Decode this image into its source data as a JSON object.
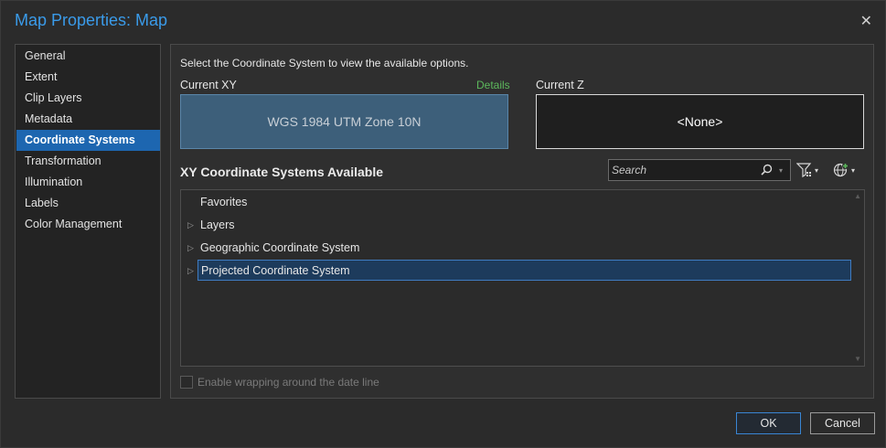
{
  "window": {
    "title": "Map Properties: Map",
    "close_glyph": "✕"
  },
  "sidebar": {
    "items": [
      {
        "label": "General",
        "selected": false
      },
      {
        "label": "Extent",
        "selected": false
      },
      {
        "label": "Clip Layers",
        "selected": false
      },
      {
        "label": "Metadata",
        "selected": false
      },
      {
        "label": "Coordinate Systems",
        "selected": true
      },
      {
        "label": "Transformation",
        "selected": false
      },
      {
        "label": "Illumination",
        "selected": false
      },
      {
        "label": "Labels",
        "selected": false
      },
      {
        "label": "Color Management",
        "selected": false
      }
    ]
  },
  "main": {
    "instruction": "Select the Coordinate System to view the available options.",
    "current_xy_label": "Current XY",
    "details_link": "Details",
    "current_xy_value": "WGS 1984 UTM Zone 10N",
    "current_z_label": "Current Z",
    "current_z_value": "<None>",
    "section_title": "XY Coordinate Systems Available",
    "search": {
      "placeholder": "Search",
      "value": ""
    },
    "tree": [
      {
        "label": "Favorites",
        "expandable": false,
        "selected": false
      },
      {
        "label": "Layers",
        "expandable": true,
        "selected": false
      },
      {
        "label": "Geographic Coordinate System",
        "expandable": true,
        "selected": false
      },
      {
        "label": "Projected Coordinate System",
        "expandable": true,
        "selected": true
      }
    ],
    "wrap_checkbox": {
      "label": "Enable wrapping around the date line",
      "checked": false,
      "enabled": false
    }
  },
  "footer": {
    "ok_label": "OK",
    "cancel_label": "Cancel"
  },
  "colors": {
    "accent": "#1d66b0",
    "title": "#3a9bea",
    "details": "#5cb85c",
    "xy_fill": "#3d5f7a"
  },
  "icons": [
    "close-icon",
    "search-icon",
    "filter-icon",
    "globe-add-icon",
    "expand-triangle-icon",
    "scroll-up-icon",
    "scroll-down-icon"
  ]
}
